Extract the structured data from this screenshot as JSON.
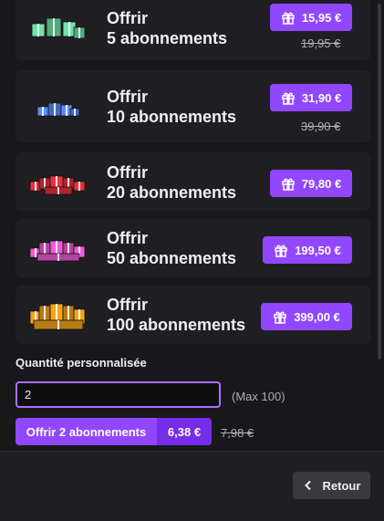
{
  "offers": [
    {
      "line1": "Offrir",
      "line2": "5 abonnements",
      "price": "15,95 €",
      "old_price": "19,95 €",
      "color": "#6fe3a8",
      "icon": "gift-pile-green-icon"
    },
    {
      "line1": "Offrir",
      "line2": "10 abonnements",
      "price": "31,90 €",
      "old_price": "39,90 €",
      "color": "#5a8cff",
      "icon": "gift-pile-blue-icon"
    },
    {
      "line1": "Offrir",
      "line2": "20 abonnements",
      "price": "79,80 €",
      "old_price": "",
      "color": "#e8313b",
      "icon": "gift-pile-red-icon"
    },
    {
      "line1": "Offrir",
      "line2": "50 abonnements",
      "price": "199,50 €",
      "old_price": "",
      "color": "#f05ad6",
      "icon": "gift-pile-pink-icon"
    },
    {
      "line1": "Offrir",
      "line2": "100 abonnements",
      "price": "399,00 €",
      "old_price": "",
      "color": "#f3a51c",
      "icon": "gift-pile-gold-icon"
    }
  ],
  "custom": {
    "label": "Quantité personnalisée",
    "value": "2",
    "max_hint": "(Max 100)",
    "button_label": "Offrir 2 abonnements",
    "button_price": "6,38 €",
    "old_price": "7,98 €"
  },
  "footer": {
    "back_label": "Retour"
  },
  "colors": {
    "accent": "#9147ff",
    "background": "#18181b",
    "card": "#1f1f23"
  }
}
